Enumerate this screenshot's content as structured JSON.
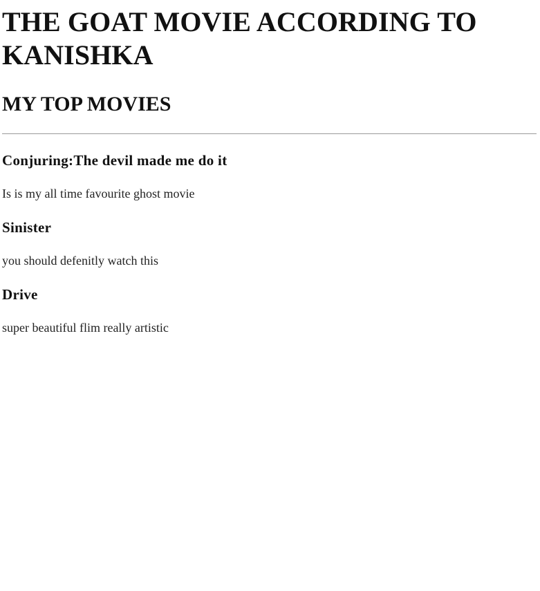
{
  "header": {
    "title": "THE GOAT MOVIE ACCORDING TO KANISHKA",
    "subtitle": "MY TOP MOVIES"
  },
  "movies": [
    {
      "title": "Conjuring:The devil made me do it",
      "description": "Is is my all time favourite ghost movie"
    },
    {
      "title": "Sinister",
      "description": "you should defenitly watch this"
    },
    {
      "title": "Drive",
      "description": "super beautiful flim really artistic"
    }
  ]
}
